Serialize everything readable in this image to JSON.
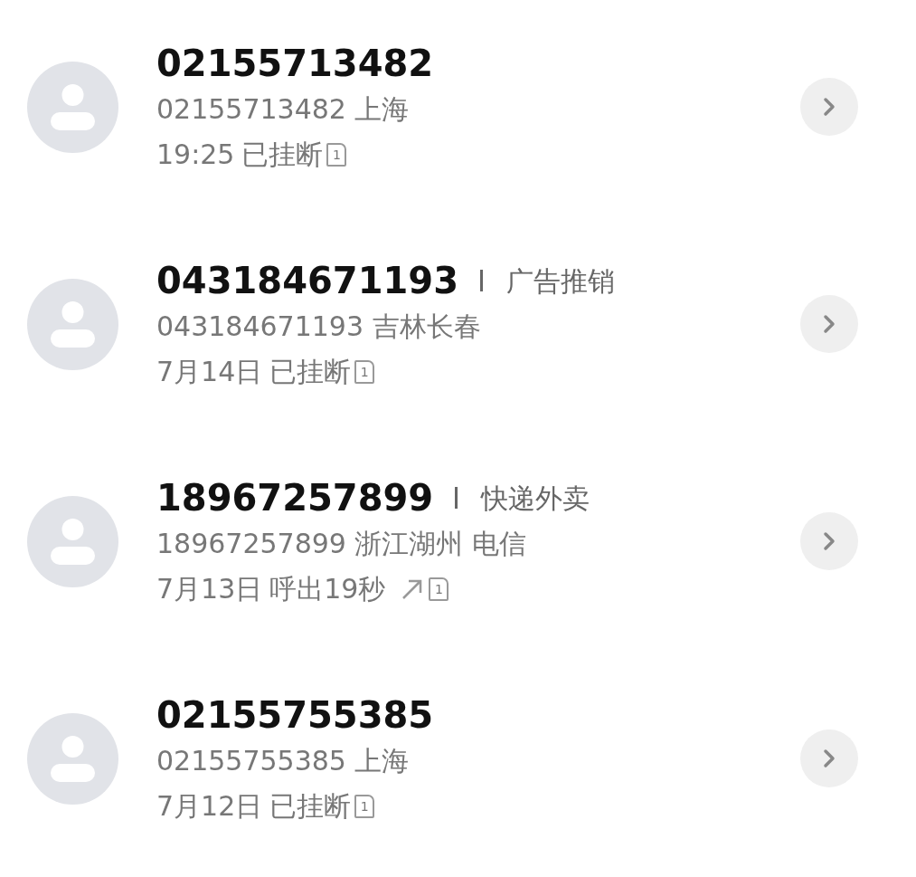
{
  "calls": [
    {
      "number": "02155713482",
      "detail": "02155713482 上海",
      "time": "19:25",
      "status": "已挂断",
      "outgoing": false,
      "sim": "1"
    },
    {
      "number": "043184671193",
      "tag": "广告推销",
      "detail": "043184671193 吉林长春",
      "time": "7月14日",
      "status": "已挂断",
      "outgoing": false,
      "sim": "1"
    },
    {
      "number": "18967257899",
      "tag": "快递外卖",
      "detail": "18967257899 浙江湖州 电信",
      "time": "7月13日",
      "status": "呼出19秒",
      "outgoing": true,
      "sim": "1"
    },
    {
      "number": "02155755385",
      "detail": "02155755385 上海",
      "time": "7月12日",
      "status": "已挂断",
      "outgoing": false,
      "sim": "1"
    }
  ]
}
